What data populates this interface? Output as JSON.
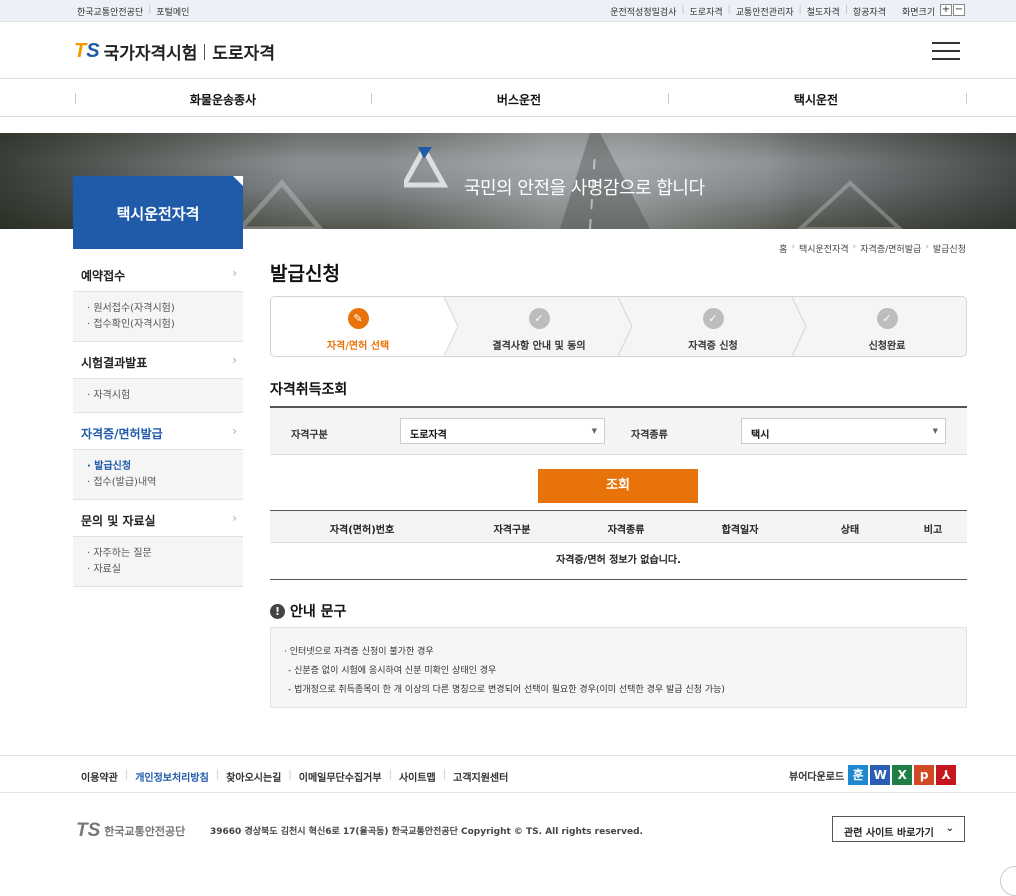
{
  "util": {
    "left": [
      "한국교통안전공단",
      "포털메인"
    ],
    "right": [
      "운전적성정밀검사",
      "도로자격",
      "교통안전관리자",
      "철도자격",
      "항공자격"
    ],
    "zoom_label": "화면크기",
    "zoom_in": "+",
    "zoom_out": "−"
  },
  "header": {
    "logo_t": "T",
    "logo_s": "S",
    "logo_name": "국가자격시험",
    "logo_sub": "도로자격"
  },
  "gnb": [
    "화물운송종사",
    "버스운전",
    "택시운전"
  ],
  "banner": {
    "slogan": "국민의 안전을 사명감으로 합니다"
  },
  "side_title": "택시운전자격",
  "lnb": [
    {
      "label": "예약접수",
      "on": false,
      "subs": [
        {
          "label": "· 원서접수(자격시험)",
          "on": false
        },
        {
          "label": "· 접수확인(자격시험)",
          "on": false
        }
      ]
    },
    {
      "label": "시험결과발표",
      "on": false,
      "subs": [
        {
          "label": "· 자격시험",
          "on": false
        }
      ]
    },
    {
      "label": "자격증/면허발급",
      "on": true,
      "subs": [
        {
          "label": "· 발급신청",
          "on": true
        },
        {
          "label": "· 접수(발급)내역",
          "on": false
        }
      ]
    },
    {
      "label": "문의 및 자료실",
      "on": false,
      "subs": [
        {
          "label": "· 자주하는 질문",
          "on": false
        },
        {
          "label": "· 자료실",
          "on": false
        }
      ]
    }
  ],
  "lnb_arrow": "›",
  "breadcrumb": [
    "홈",
    "택시운전자격",
    "자격증/면허발급",
    "발급신청"
  ],
  "breadcrumb_sep": "›",
  "page_title": "발급신청",
  "steps": [
    {
      "label": "자격/면허 선택",
      "on": true
    },
    {
      "label": "결격사항 안내 및 동의",
      "on": false
    },
    {
      "label": "자격증 신청",
      "on": false
    },
    {
      "label": "신청완료",
      "on": false
    }
  ],
  "section_title": "자격취득조회",
  "search": {
    "category_label": "자격구분",
    "category_value": "도로자격",
    "type_label": "자격종류",
    "type_value": "택시",
    "button": "조회"
  },
  "table": {
    "headers": [
      "자격(면허)번호",
      "자격구분",
      "자격종류",
      "합격일자",
      "상태",
      "비고"
    ],
    "empty_message": "자격증/면허 정보가 없습니다."
  },
  "notice": {
    "title": "안내 문구",
    "icon": "!",
    "lines": [
      "· 인터넷으로 자격증 신청이 불가한 경우",
      "  - 신분증 없이 시험에 응시하여 신분 미확인 상태인 경우",
      "  - 법개정으로 취득종목이 한 개 이상의 다른 명칭으로 변경되어 선택이 필요한 경우(이미 선택한 경우 발급 신청 가능)"
    ]
  },
  "footer": {
    "links": [
      "이용약관",
      "개인정보처리방침",
      "찾아오시는길",
      "이메일무단수집거부",
      "사이트맵",
      "고객지원센터"
    ],
    "viewer_label": "뷰어다운로드",
    "viewers": [
      {
        "name": "hangul-viewer-icon",
        "glyph": "훈",
        "color": "#1e88d0"
      },
      {
        "name": "word-viewer-icon",
        "glyph": "W",
        "color": "#2b5fb4"
      },
      {
        "name": "excel-viewer-icon",
        "glyph": "X",
        "color": "#1e7e45"
      },
      {
        "name": "powerpoint-viewer-icon",
        "glyph": "p",
        "color": "#d24a24"
      },
      {
        "name": "pdf-viewer-icon",
        "glyph": "⅄",
        "color": "#c4161c"
      }
    ],
    "logo_ts": "TS",
    "logo_name": "한국교통안전공단",
    "address": "39660 경상북도 김천시 혁신6로 17(율곡동) 한국교통안전공단   Copyright © TS. All rights reserved.",
    "related_sites": "관련 사이트 바로가기",
    "related_chevron": "⌄"
  },
  "colors": {
    "accent": "#e8730a",
    "brand_blue": "#1f5ba8",
    "step_done": "#bdbdbd"
  }
}
